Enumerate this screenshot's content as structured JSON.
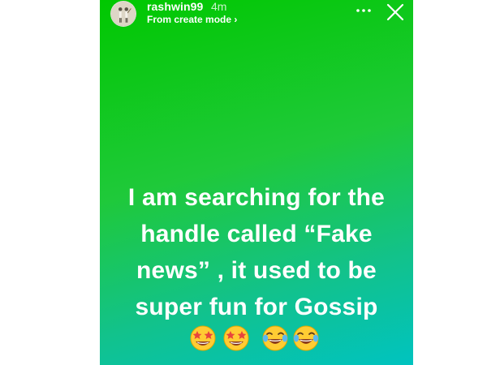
{
  "story": {
    "username": "rashwin99",
    "timestamp": "4m",
    "subtitle": "From create mode ›",
    "text_lines": [
      "I am searching for the",
      "handle called “Fake",
      "news” , it used to be",
      "super fun for Gossip"
    ],
    "emojis": [
      "star-struck-emoji",
      "star-struck-emoji",
      "tears-of-joy-emoji",
      "tears-of-joy-emoji"
    ],
    "colors": {
      "gradient_top": "#00c800",
      "gradient_bottom": "#00c3c0",
      "text": "#ffffff"
    }
  }
}
